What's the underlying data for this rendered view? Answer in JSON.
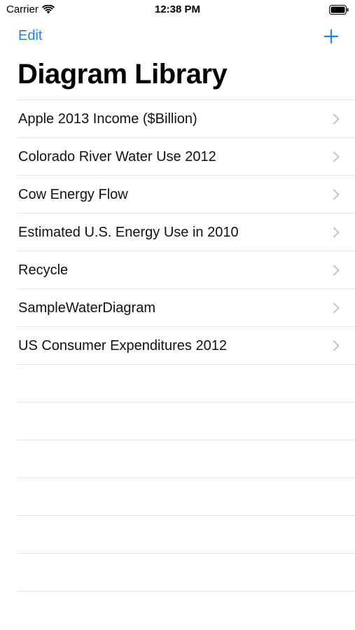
{
  "status_bar": {
    "carrier": "Carrier",
    "time": "12:38 PM",
    "wifi_icon": "wifi-icon",
    "battery_icon": "battery-icon"
  },
  "nav": {
    "edit_label": "Edit",
    "add_icon": "plus-icon"
  },
  "title": "Diagram Library",
  "accent_color": "#1a82f7",
  "list": {
    "items": [
      {
        "label": "Apple 2013 Income ($Billion)"
      },
      {
        "label": "Colorado River Water Use 2012"
      },
      {
        "label": "Cow Energy Flow"
      },
      {
        "label": "Estimated U.S. Energy Use in 2010"
      },
      {
        "label": "Recycle"
      },
      {
        "label": "SampleWaterDiagram"
      },
      {
        "label": "US Consumer Expenditures 2012"
      }
    ],
    "chevron_icon": "chevron-right-icon"
  }
}
